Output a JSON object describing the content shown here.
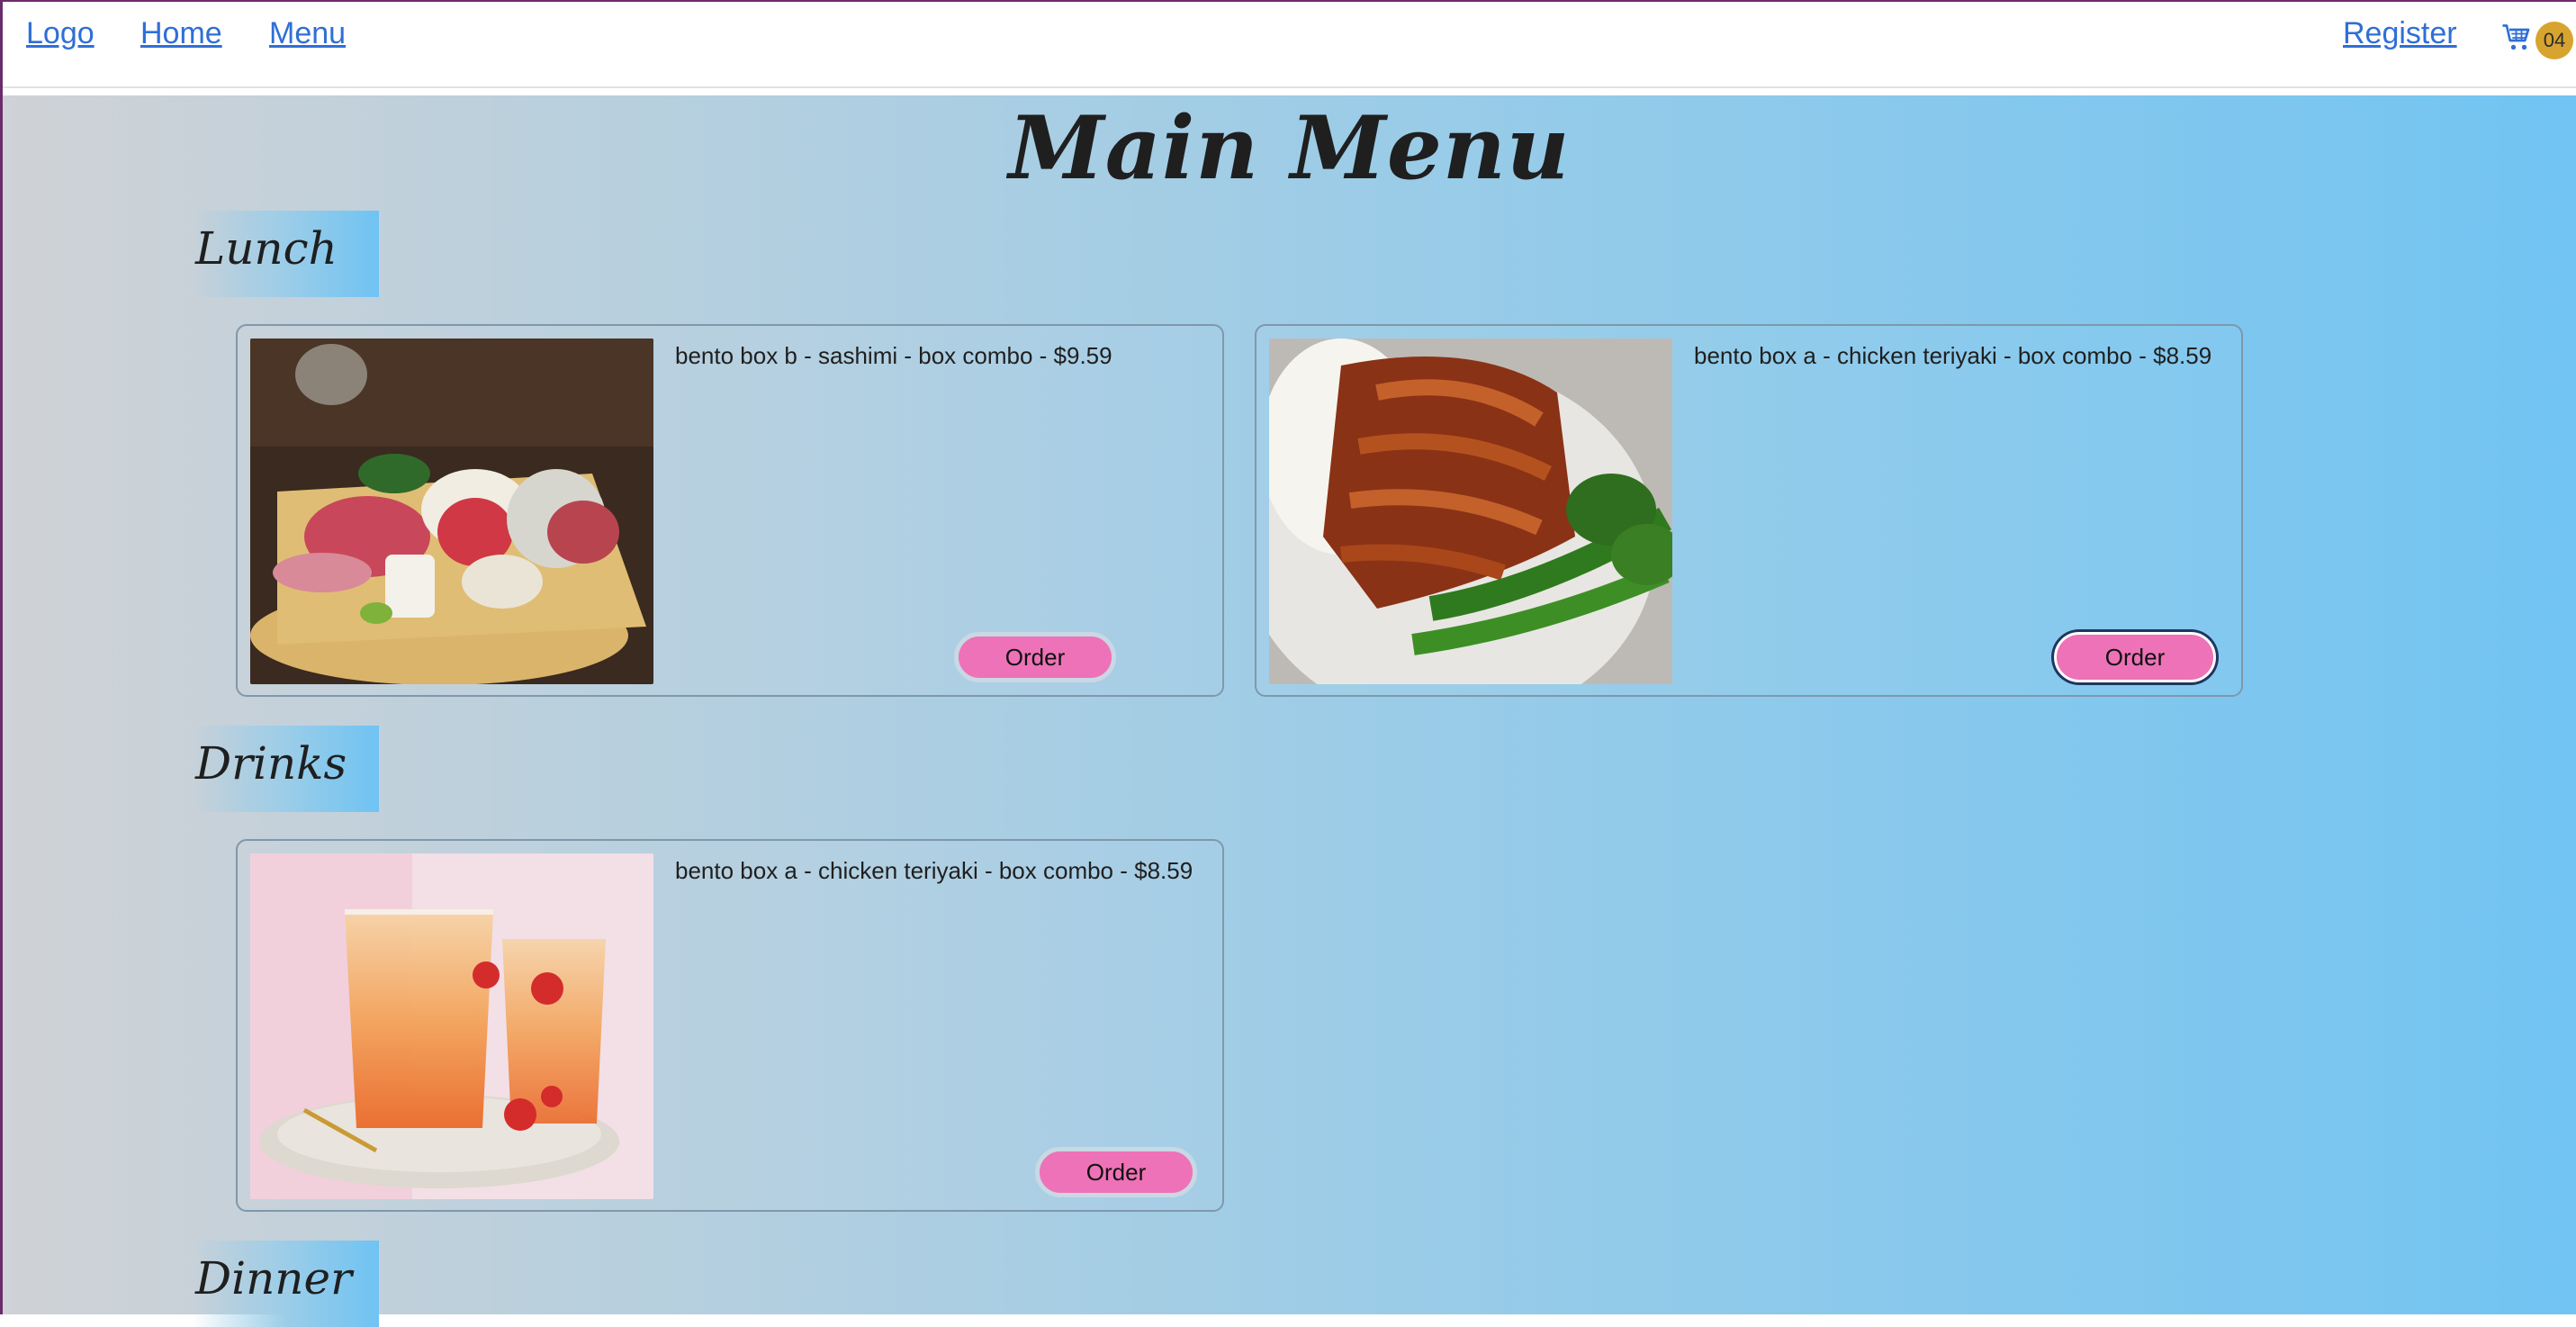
{
  "nav": {
    "logo": "Logo",
    "home": "Home",
    "menu": "Menu",
    "register": "Register",
    "cart_icon": "shopping-cart-icon",
    "cart_count": "04"
  },
  "page": {
    "title": "Main Menu"
  },
  "sections": [
    {
      "heading": "Lunch",
      "items": [
        {
          "text": "bento box b - sashimi - box combo - $9.59",
          "order_label": "Order",
          "image": "sashimi-platter"
        },
        {
          "text": "bento box a - chicken teriyaki - box combo - $8.59",
          "order_label": "Order",
          "image": "chicken-teriyaki"
        }
      ]
    },
    {
      "heading": "Drinks",
      "items": [
        {
          "text": "bento box a - chicken teriyaki - box combo - $8.59",
          "order_label": "Order",
          "image": "orange-drinks"
        }
      ]
    },
    {
      "heading": "Dinner",
      "items": []
    }
  ],
  "colors": {
    "link": "#2f6fd6",
    "order_button": "#ee72b7",
    "cart_badge": "#d7a42f",
    "gradient_start": "#cfd2d6",
    "gradient_end": "#72c4f2"
  }
}
